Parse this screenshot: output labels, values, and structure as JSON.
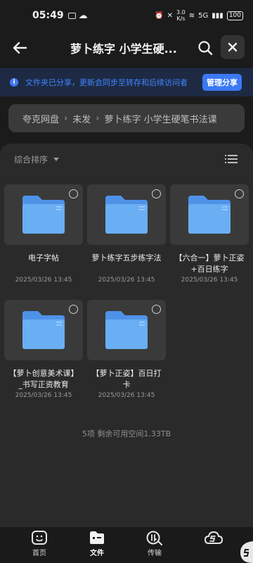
{
  "status": {
    "time": "05:49",
    "battery": "100",
    "speed_value": "3.0",
    "speed_unit": "K/s",
    "network": "5G"
  },
  "header": {
    "title": "萝卜练字 小学生硬..."
  },
  "share_banner": {
    "text": "文件夹已分享，更新会同步至转存和后续访问者",
    "manage_label": "管理分享",
    "accent": "#3b79f4"
  },
  "breadcrumb": {
    "items": [
      "夸克网盘",
      "未发",
      "萝卜练字 小学生硬笔书法课"
    ]
  },
  "toolbar": {
    "sort_label": "综合排序"
  },
  "folders": [
    {
      "name": "电子字帖",
      "date": "2025/03/26 13:45"
    },
    {
      "name": "萝卜练字五步练字法",
      "date": "2025/03/26 13:45"
    },
    {
      "name": "【六合一】萝卜正姿+百日练字",
      "date": "2025/03/26 13:45"
    },
    {
      "name": "【萝卜创意美术课】_书写正资教育",
      "date": "2025/03/26 13:45"
    },
    {
      "name": "【萝卜正姿】百日打卡",
      "date": "2025/03/26 13:45"
    }
  ],
  "footer": {
    "summary": "5项 剩余可用空间1.33TB"
  },
  "nav": {
    "items": [
      "首页",
      "文件",
      "传输"
    ]
  }
}
